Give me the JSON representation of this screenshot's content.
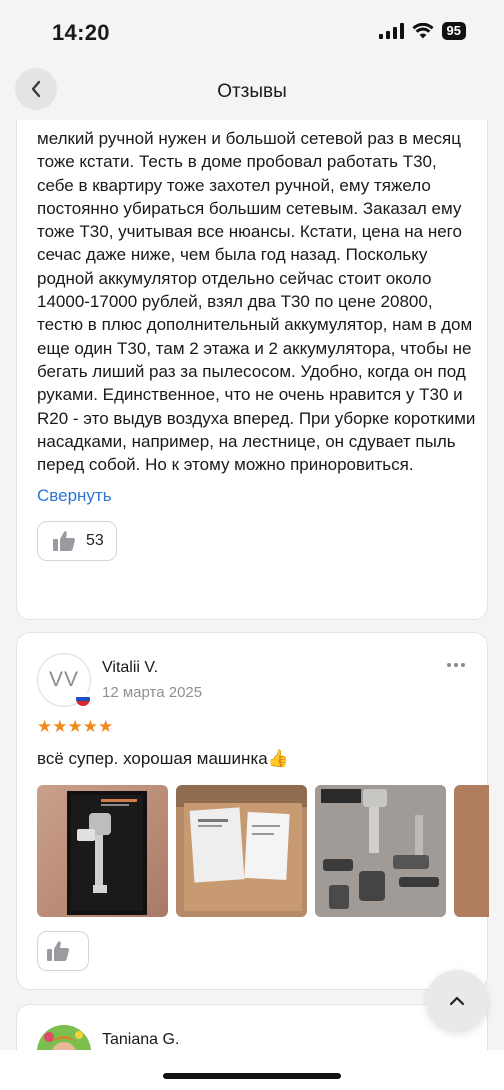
{
  "status_bar": {
    "time": "14:20",
    "battery": "95"
  },
  "header": {
    "title": "Отзывы",
    "back_icon": "chevron-left-icon"
  },
  "review_expanded": {
    "text": "мелкий ручной нужен и большой сетевой раз в месяц тоже кстати. Тесть в доме пробовал работать Т30, себе в квартиру тоже захотел ручной, ему тяжело постоянно убираться большим сетевым. Заказал ему тоже Т30, учитывая все нюансы. Кстати, цена на него сечас даже ниже, чем была год назад. Поскольку родной аккумулятор отдельно сейчас стоит около 14000-17000 рублей, взял два Т30 по цене 20800, тестю в плюс дополнительный аккумулятор, нам в дом еще один Т30, там 2 этажа и 2 аккумулятора, чтобы не бегать лиший раз за пылесосом. Удобно, когда он под руками. Единственное, что не очень нравится у Т30 и R20 - это выдув воздуха вперед. При уборке короткими насадками, например, на лестнице, он сдувает пыль перед собой. Но к этому можно приноровиться.",
    "collapse_label": "Свернуть",
    "likes": "53"
  },
  "review_2": {
    "avatar_initials": "VV",
    "author": "Vitalii V.",
    "date": "12 марта 2025",
    "rating": 5,
    "stars": "★★★★★",
    "text": "всё супер. хорошая машинка👍",
    "photos": [
      "photo-vacuum-box",
      "photo-manual-booklet",
      "photo-vacuum-parts",
      "photo-partial"
    ],
    "likes": ""
  },
  "review_3": {
    "author": "Taniana G."
  },
  "colors": {
    "link": "#2b76d4",
    "star": "#f08a1a",
    "background": "#f4f4f5"
  }
}
